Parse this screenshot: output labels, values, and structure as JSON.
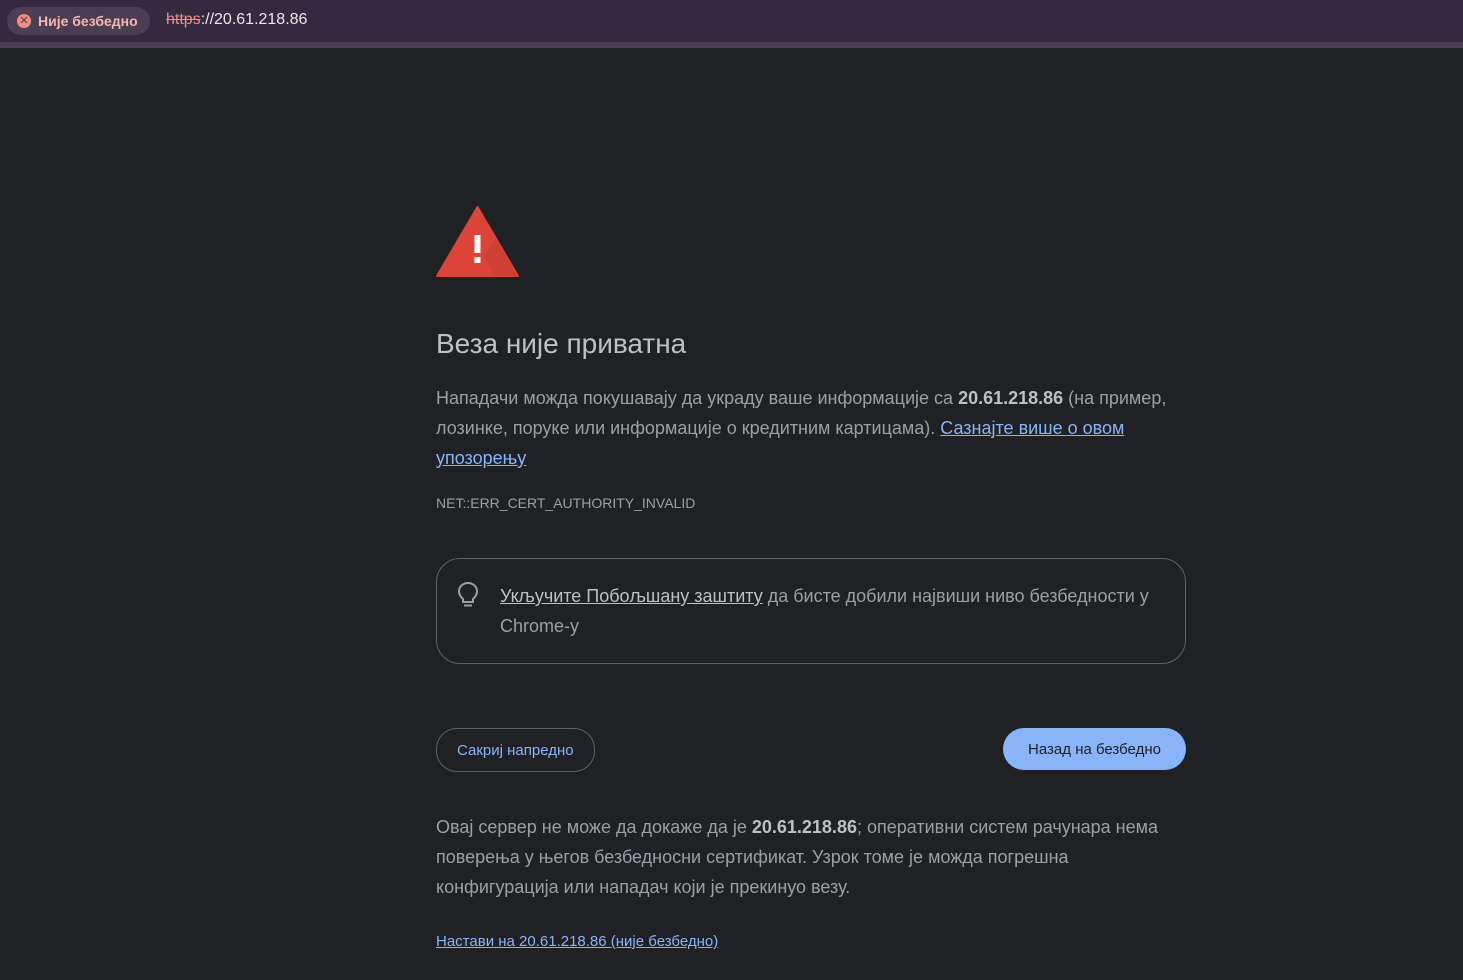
{
  "address_bar": {
    "security_label": "Није безбедно",
    "url_scheme": "https",
    "url_rest": "://20.61.218.86"
  },
  "interstitial": {
    "title": "Веза није приватна",
    "main_text_before": "Нападачи можда покушавају да украду ваше информације са ",
    "host": "20.61.218.86",
    "main_text_after": " (на пример, лозинке, поруке или информације о кредитним картицама). ",
    "learn_more_link": "Сазнајте више о овом упозорењу",
    "error_code": "NET::ERR_CERT_AUTHORITY_INVALID",
    "esb_link": "Укључите Побољшану заштиту",
    "esb_text": " да бисте добили највиши ниво безбедности у Chrome-у",
    "hide_advanced_button": "Сакриј напредно",
    "back_to_safety_button": "Назад на безбедно",
    "details_before": "Овај сервер не може да докаже да је ",
    "details_host": "20.61.218.86",
    "details_after": "; оперативни систем рачунара нема поверења у његов безбедносни сертификат. Узрок томе је можда погрешна конфигурација или нападач који је прекинуо везу.",
    "proceed_link": "Настави на 20.61.218.86 (није безбедно)"
  },
  "icons": {
    "security_chip": "error-circle-icon",
    "warning": "warning-triangle-icon",
    "esb": "lightbulb-icon"
  },
  "colors": {
    "background": "#202124",
    "topbar": "#35293d",
    "warning_red": "#db4437",
    "link_blue": "#8ab4f8",
    "primary_button": "#8ab4f8"
  }
}
